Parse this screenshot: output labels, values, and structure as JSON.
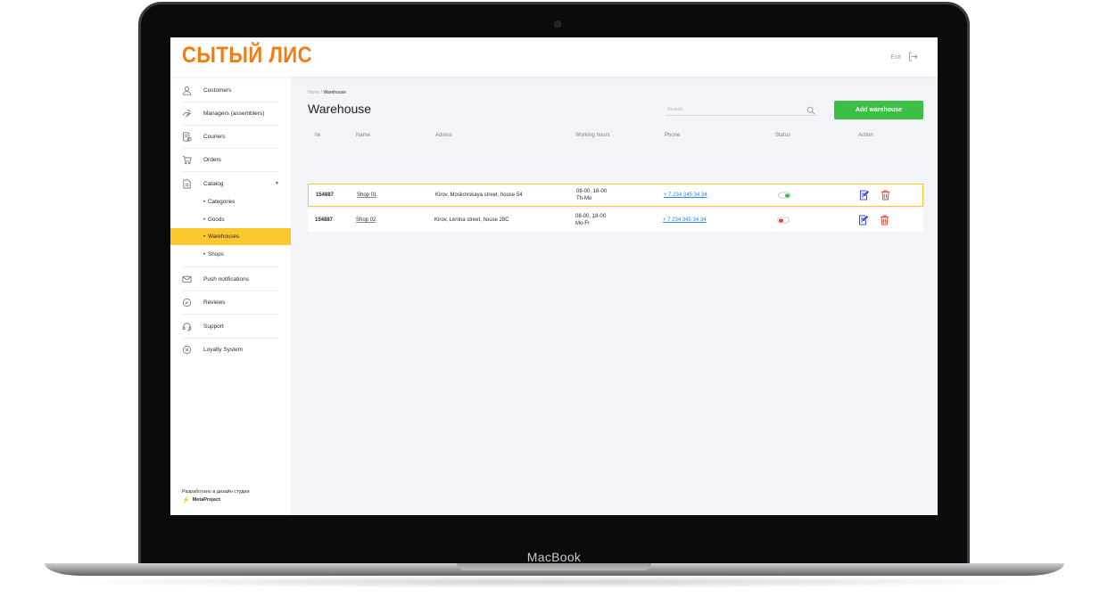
{
  "device": {
    "label": "MacBook"
  },
  "header": {
    "logo": "СЫТЫЙ ЛИС",
    "exit_label": "Exit"
  },
  "sidebar": {
    "items": [
      {
        "label": "Customers",
        "icon": "user-icon"
      },
      {
        "label": "Managers (assemblers)",
        "icon": "hand-icon"
      },
      {
        "label": "Couriers",
        "icon": "courier-icon"
      },
      {
        "label": "Orders",
        "icon": "cart-icon"
      },
      {
        "label": "Catalog",
        "icon": "document-icon"
      },
      {
        "label": "Push notifications",
        "icon": "mail-icon"
      },
      {
        "label": "Reviews",
        "icon": "chat-icon"
      },
      {
        "label": "Support",
        "icon": "headset-icon"
      },
      {
        "label": "Loyalty System",
        "icon": "badge-icon"
      }
    ],
    "catalog_sub": [
      "Categories",
      "Goods",
      "Warehouses",
      "Shops"
    ],
    "active_sub": "Warehouses",
    "footer_line": "Разработано в дизайн студии",
    "footer_brand": "MetaProject"
  },
  "main": {
    "breadcrumb_home": "Home",
    "breadcrumb_sep": "/",
    "breadcrumb_current": "Warehouse",
    "title": "Warehouse",
    "search_placeholder": "Search",
    "add_button": "Add warehouse",
    "columns": [
      "№",
      "Name",
      "Adress",
      "Working hours",
      "Phone",
      "Status",
      "Action"
    ],
    "rows": [
      {
        "id": "154887",
        "name": "Shop 01",
        "address": "Kirov, Moskovskaya street, house 54",
        "hours_1": "08-00, 18-00",
        "hours_2": "Th-Mo",
        "phone": "+ 7 234 345 34 34",
        "status": "on"
      },
      {
        "id": "154887",
        "name": "Shop 02",
        "address": "Kirov, Lenina street, house 28C",
        "hours_1": "08-00, 18-00",
        "hours_2": "Mo-Fr",
        "phone": "+ 7 234 345 34 34",
        "status": "off"
      }
    ]
  },
  "colors": {
    "accent": "#fdc72e",
    "logo": "#f47b10",
    "primary_button": "#3cbf44",
    "status_on": "#3cbf44",
    "status_off": "#e8413b",
    "edit_icon": "#3d4fd8",
    "delete_icon": "#e8413b",
    "phone_link": "#2d7ff2"
  }
}
